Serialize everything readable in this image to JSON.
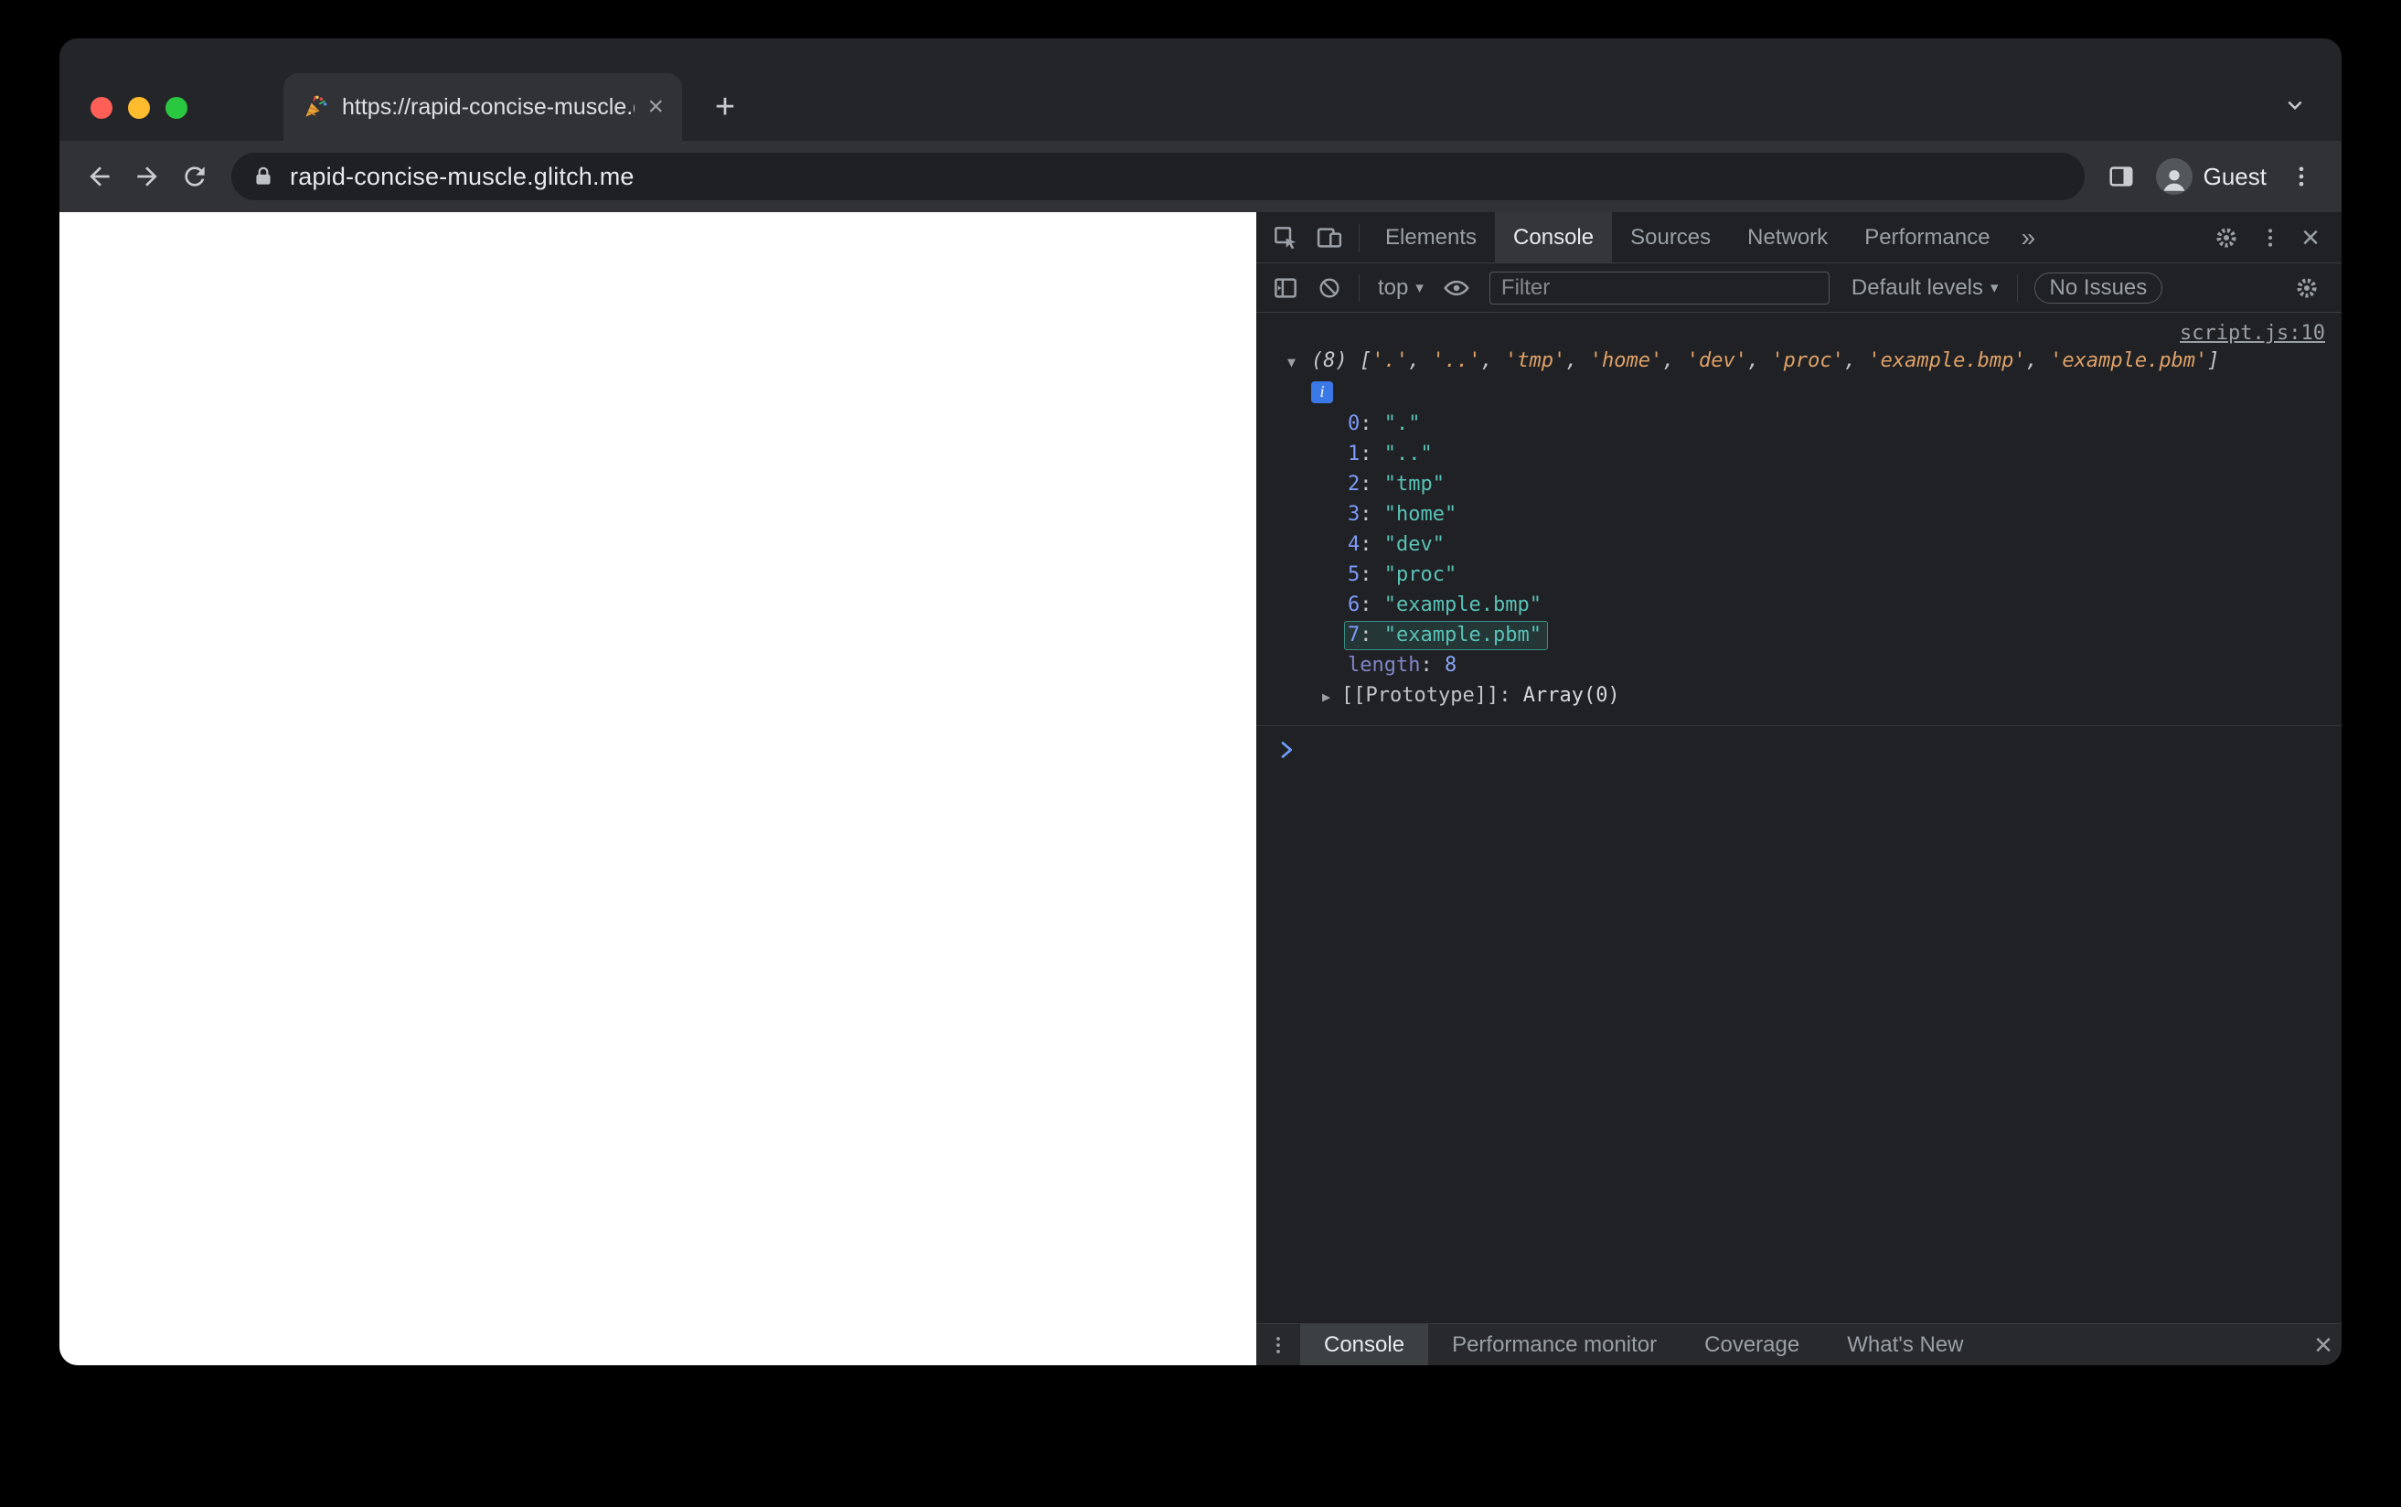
{
  "window": {
    "tab_title": "https://rapid-concise-muscle.g",
    "url": "rapid-concise-muscle.glitch.me",
    "profile": "Guest"
  },
  "devtools": {
    "panel_tabs": [
      "Elements",
      "Console",
      "Sources",
      "Network",
      "Performance"
    ],
    "active_panel": "Console",
    "toolbar": {
      "context_selector": "top",
      "filter_placeholder": "Filter",
      "levels_label": "Default levels",
      "issues_label": "No Issues"
    },
    "console": {
      "source_link": "script.js:10",
      "array_preview_count": "(8)",
      "items": [
        ".",
        "..",
        "tmp",
        "home",
        "dev",
        "proc",
        "example.bmp",
        "example.pbm"
      ],
      "highlighted_index": 7,
      "length_label": "length",
      "length_value": "8",
      "prototype_label": "[[Prototype]]:",
      "prototype_value": "Array(0)"
    },
    "drawer_tabs": [
      "Console",
      "Performance monitor",
      "Coverage",
      "What's New"
    ],
    "active_drawer_tab": "Console"
  },
  "glyphs": {
    "close": "×",
    "plus": "+",
    "caret": "▾",
    "tree_expanded": "▼",
    "tree_collapsed": "▶",
    "info": "i",
    "more_tabs": "»"
  },
  "colors": {
    "preview_string": "#dfa168",
    "index": "#7d9af8",
    "string_value": "#58c2b7",
    "number": "#86a5f7",
    "length_label": "#7f86c7",
    "highlight_border": "#3a8e84",
    "highlight_fill": "rgba(80,200,188,0.13)",
    "link": "#9aa0a6",
    "prompt": "#6e9ef7",
    "accent_blue_info": "#3b78e7"
  }
}
